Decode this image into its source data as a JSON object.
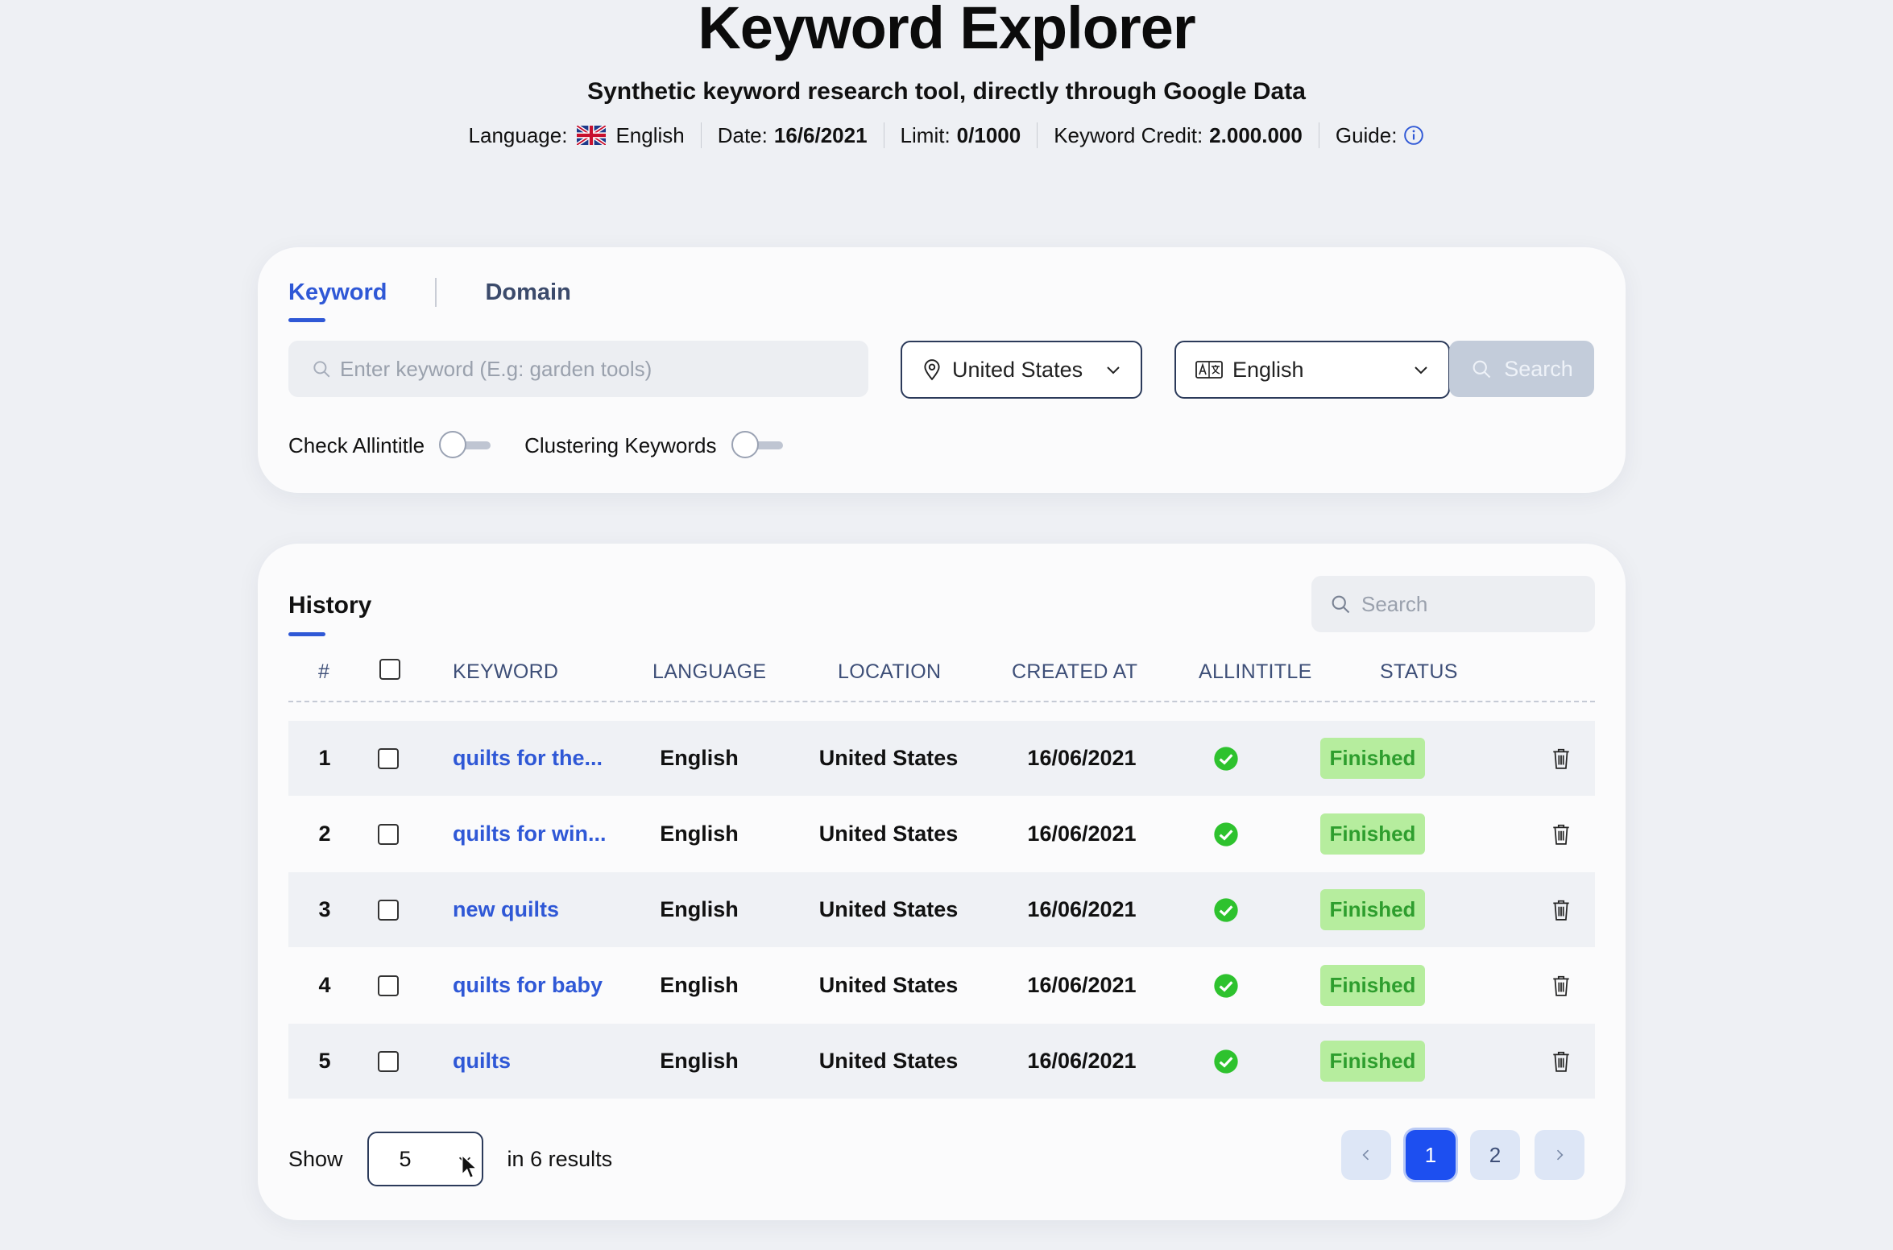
{
  "header": {
    "title": "Keyword Explorer",
    "subtitle": "Synthetic keyword research tool, directly through Google Data",
    "language_label": "Language:",
    "language_value": "English",
    "date_label": "Date:",
    "date_value": "16/6/2021",
    "limit_label": "Limit:",
    "limit_value": "0/1000",
    "credit_label": "Keyword Credit:",
    "credit_value": "2.000.000",
    "guide_label": "Guide:"
  },
  "search_card": {
    "tabs": [
      {
        "label": "Keyword",
        "active": true
      },
      {
        "label": "Domain",
        "active": false
      }
    ],
    "keyword_placeholder": "Enter keyword (E.g: garden tools)",
    "location_value": "United States",
    "language_value": "English",
    "search_button": "Search",
    "toggles": [
      {
        "label": "Check Allintitle",
        "on": false
      },
      {
        "label": "Clustering Keywords",
        "on": false
      }
    ]
  },
  "history": {
    "title": "History",
    "search_placeholder": "Search",
    "columns": [
      "#",
      "KEYWORD",
      "LANGUAGE",
      "LOCATION",
      "CREATED AT",
      "ALLINTITLE",
      "STATUS"
    ],
    "rows": [
      {
        "num": "1",
        "keyword": "quilts for the...",
        "language": "English",
        "location": "United States",
        "created": "16/06/2021",
        "allintitle": true,
        "status": "Finished"
      },
      {
        "num": "2",
        "keyword": "quilts for win...",
        "language": "English",
        "location": "United States",
        "created": "16/06/2021",
        "allintitle": true,
        "status": "Finished"
      },
      {
        "num": "3",
        "keyword": "new quilts",
        "language": "English",
        "location": "United States",
        "created": "16/06/2021",
        "allintitle": true,
        "status": "Finished"
      },
      {
        "num": "4",
        "keyword": "quilts for baby",
        "language": "English",
        "location": "United States",
        "created": "16/06/2021",
        "allintitle": true,
        "status": "Finished"
      },
      {
        "num": "5",
        "keyword": "quilts",
        "language": "English",
        "location": "United States",
        "created": "16/06/2021",
        "allintitle": true,
        "status": "Finished"
      }
    ],
    "show_label": "Show",
    "show_value": "5",
    "results_text": "in 6 results",
    "pages": [
      "1",
      "2"
    ],
    "current_page": "1"
  },
  "colors": {
    "accent": "#2f58d6",
    "primary_button": "#1d4ff0",
    "status_green": "#2e9e2e",
    "status_bg": "#b6ed9e",
    "check_green": "#2ec22e"
  }
}
